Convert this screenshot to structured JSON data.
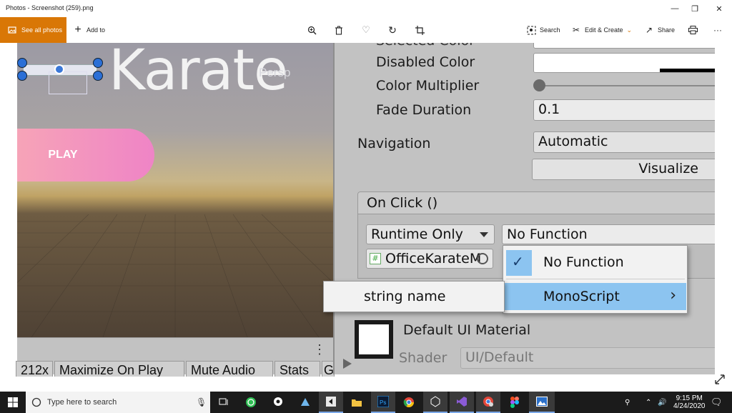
{
  "window": {
    "title": "Photos - Screenshot (259).png",
    "minimize_glyph": "—",
    "restore_glyph": "❐",
    "close_glyph": "✕"
  },
  "toolbar": {
    "see_all": "See all photos",
    "add_to": "Add to",
    "search": "Search",
    "edit_create": "Edit & Create",
    "share": "Share",
    "more_glyph": "···"
  },
  "scene": {
    "logo_text": "Karate",
    "persp_label": "Persp",
    "play_label": "PLAY",
    "menu_dots": "⋮",
    "bottom_tabs": [
      "212x",
      "Maximize On Play",
      "Mute Audio",
      "Stats",
      "G"
    ]
  },
  "inspector": {
    "cut_label": "Selected Color",
    "disabled_color": "Disabled Color",
    "color_multiplier": "Color Multiplier",
    "fade_duration": "Fade Duration",
    "fade_value": "0.1",
    "navigation": "Navigation",
    "navigation_value": "Automatic",
    "visualize": "Visualize",
    "on_click": "On Click ()",
    "runtime_only": "Runtime Only",
    "no_function": "No Function",
    "object_field": "OfficeKarateM",
    "material_name": "Default UI Material",
    "shader_label": "Shader",
    "shader_value": "UI/Default"
  },
  "function_menu": {
    "no_function": "No Function",
    "monoscript": "MonoScript",
    "submenu_arrow": "›"
  },
  "submenu": {
    "string_name": "string name"
  },
  "taskbar": {
    "search_placeholder": "Type here to search",
    "time": "9:15 PM",
    "date": "4/24/2020"
  },
  "colors": {
    "accent_orange": "#d97706",
    "highlight_blue": "#8cc4f0",
    "inspector_bg": "#c2c2c2",
    "taskbar_bg": "#1b1b1b"
  }
}
